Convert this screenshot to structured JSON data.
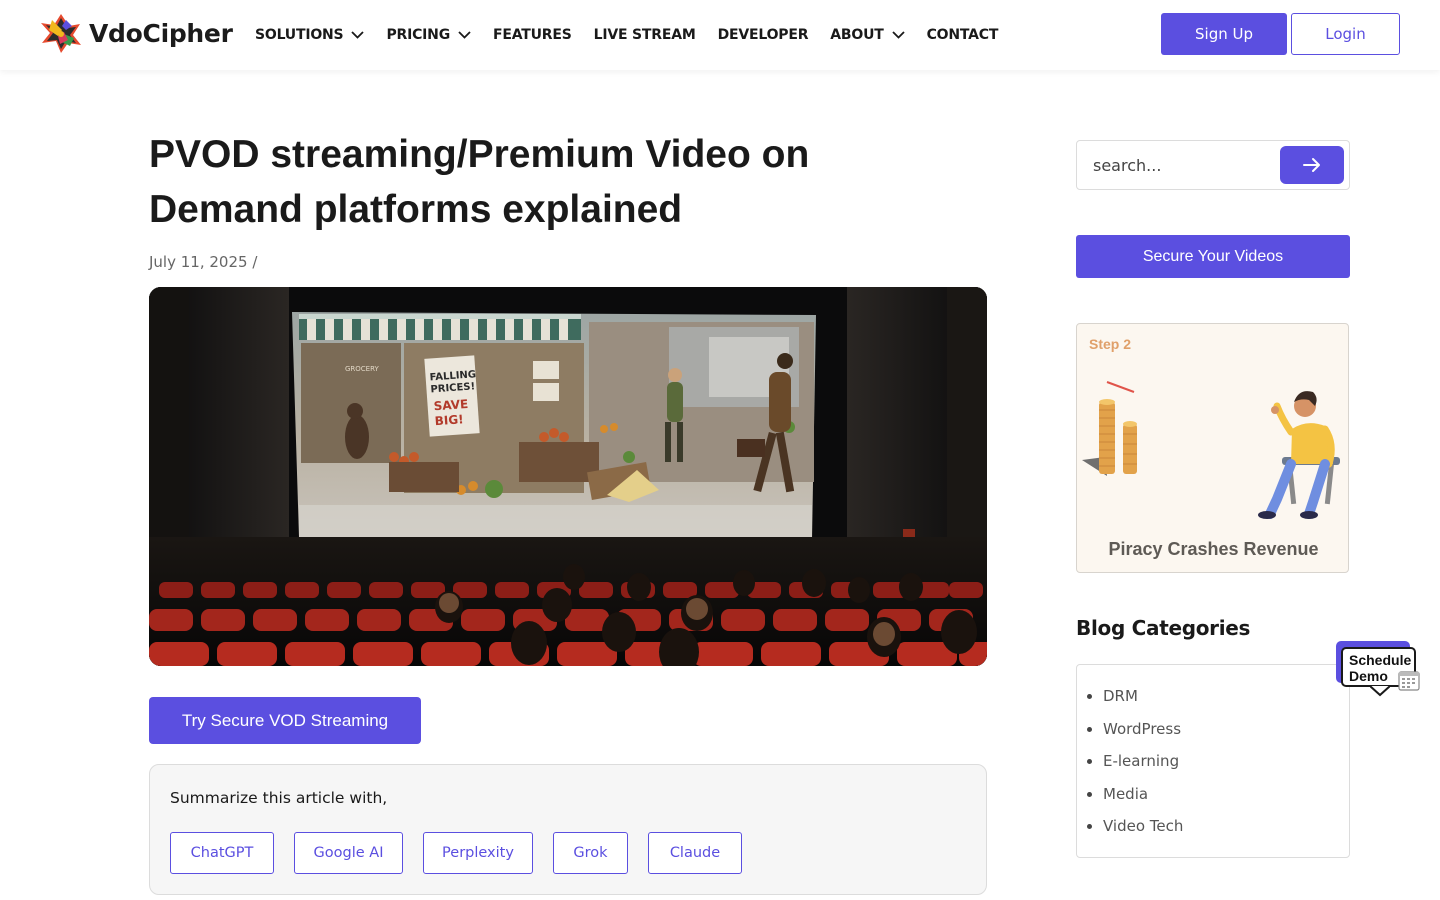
{
  "brand": {
    "name": "VdoCipher"
  },
  "nav": {
    "items": [
      {
        "label": "SOLUTIONS",
        "dropdown": true
      },
      {
        "label": "PRICING",
        "dropdown": true
      },
      {
        "label": "FEATURES",
        "dropdown": false
      },
      {
        "label": "LIVE STREAM",
        "dropdown": false
      },
      {
        "label": "DEVELOPER",
        "dropdown": false
      },
      {
        "label": "ABOUT",
        "dropdown": true
      },
      {
        "label": "CONTACT",
        "dropdown": false
      }
    ],
    "signup_label": "Sign Up",
    "login_label": "Login"
  },
  "article": {
    "title": "PVOD streaming/Premium Video on Demand platforms explained",
    "date": "July 11, 2025",
    "meta_separator": "/",
    "hero_image": {
      "sign_text_1": "FALLING",
      "sign_text_2": "PRICES!",
      "sign_text_3": "SAVE",
      "sign_text_4": "BIG!",
      "store_label": "GROCERY"
    },
    "cta_label": "Try Secure VOD Streaming",
    "summary": {
      "label": "Summarize this article with,",
      "buttons": [
        "ChatGPT",
        "Google AI",
        "Perplexity",
        "Grok",
        "Claude"
      ]
    }
  },
  "sidebar": {
    "search_placeholder": "search...",
    "secure_label": "Secure Your Videos",
    "promo": {
      "step": "Step 2",
      "title": "Piracy Crashes Revenue"
    },
    "categories_title": "Blog Categories",
    "categories": [
      "DRM",
      "WordPress",
      "E-learning",
      "Media",
      "Video Tech"
    ]
  },
  "demo_widget": {
    "line1": "Schedule",
    "line2": "Demo"
  },
  "colors": {
    "accent": "#5b4fe0",
    "text": "#1a1a1a",
    "muted": "#666666"
  }
}
